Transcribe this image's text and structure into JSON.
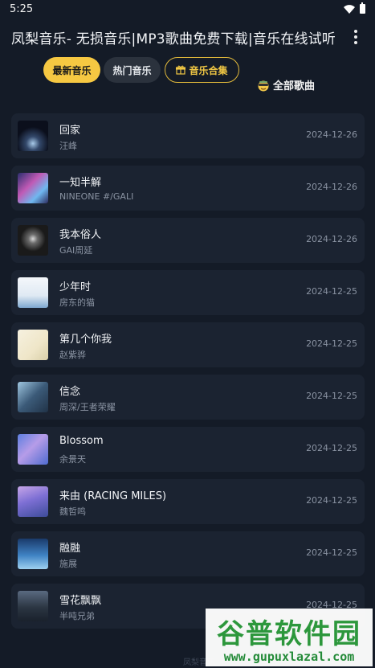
{
  "status": {
    "time": "5:25"
  },
  "app": {
    "title": "凤梨音乐- 无损音乐|MP3歌曲免费下载|音乐在线试听"
  },
  "tabs": [
    {
      "label": "最新音乐",
      "active": true
    },
    {
      "label": "热门音乐",
      "active": false
    },
    {
      "label": "音乐合集",
      "active": false
    }
  ],
  "all_songs": {
    "label": "全部歌曲"
  },
  "songs": [
    {
      "title": "回家",
      "artist": "汪峰",
      "date": "2024-12-26"
    },
    {
      "title": "一知半解",
      "artist": "NINEONE #/GALI",
      "date": "2024-12-26"
    },
    {
      "title": "我本俗人",
      "artist": "GAI周延",
      "date": "2024-12-26"
    },
    {
      "title": "少年时",
      "artist": "房东的猫",
      "date": "2024-12-25"
    },
    {
      "title": "第几个你我",
      "artist": "赵紫骅",
      "date": "2024-12-25"
    },
    {
      "title": "信念",
      "artist": "周深/王者荣耀",
      "date": "2024-12-25"
    },
    {
      "title": "Blossom",
      "artist": "余景天",
      "date": "2024-12-25"
    },
    {
      "title": "来由 (RACING MILES)",
      "artist": "魏哲鸣",
      "date": "2024-12-25"
    },
    {
      "title": "融融",
      "artist": "施展",
      "date": "2024-12-25"
    },
    {
      "title": "雪花飘飘",
      "artist": "半吨兄弟",
      "date": "2024-12-25"
    }
  ],
  "footer": {
    "hint": "凤梨音乐"
  },
  "watermark": {
    "main": "谷普软件园",
    "sub": "www.gupuxlazal.com"
  },
  "colors": {
    "accent": "#f6c842",
    "background": "#141b27",
    "card": "#1b2331"
  }
}
